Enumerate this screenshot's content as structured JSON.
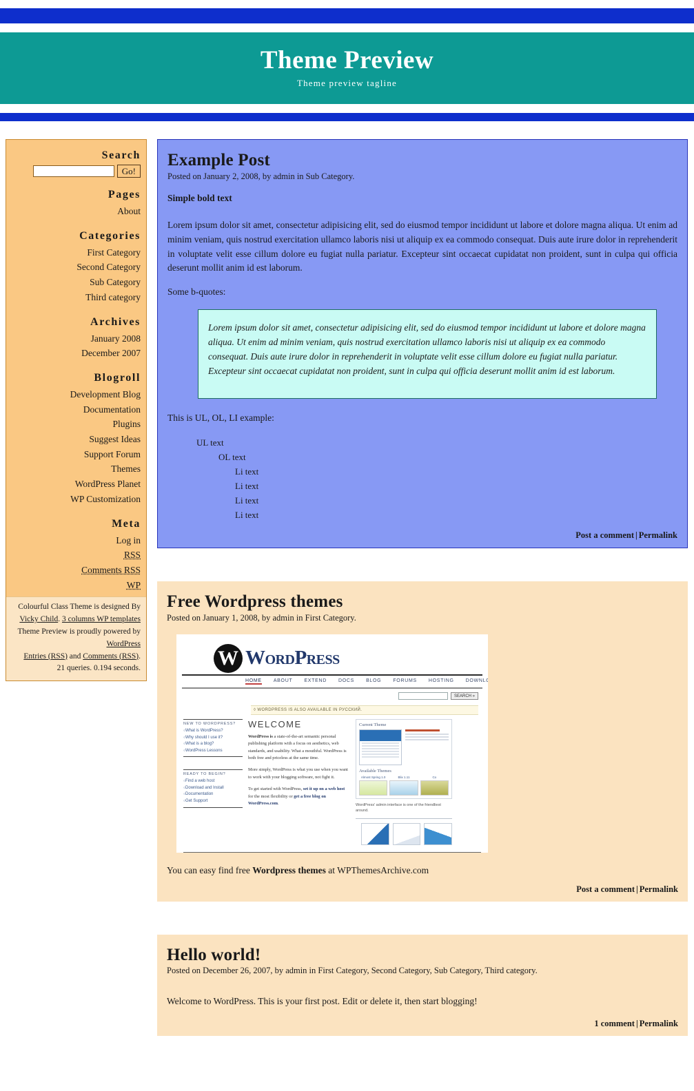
{
  "header": {
    "title": "Theme Preview",
    "tagline": "Theme preview tagline"
  },
  "colors": {
    "bar_blue": "#0e2ecc",
    "header_teal": "#0d9a94",
    "sidebar_orange": "#fac883",
    "sidebar_border": "#c98a30",
    "credit_bg": "#fbe5c5",
    "post_blue_bg": "#8799f4",
    "post_blue_border": "#2733b9",
    "post_peach_bg": "#fbe3c0",
    "blockquote_bg": "#c9fbf4",
    "blockquote_border": "#1d6b63"
  },
  "sidebar": {
    "search": {
      "heading": "Search",
      "value": "",
      "placeholder": "",
      "button_label": "Go!"
    },
    "pages": {
      "heading": "Pages",
      "items": [
        {
          "label": "About"
        }
      ]
    },
    "categories": {
      "heading": "Categories",
      "items": [
        {
          "label": "First Category",
          "sub": false
        },
        {
          "label": "Second Category",
          "sub": false
        },
        {
          "label": "Sub Category",
          "sub": true
        },
        {
          "label": "Third category",
          "sub": false
        }
      ]
    },
    "archives": {
      "heading": "Archives",
      "items": [
        {
          "label": "January 2008"
        },
        {
          "label": "December 2007"
        }
      ]
    },
    "blogroll": {
      "heading": "Blogroll",
      "items": [
        {
          "label": "Development Blog"
        },
        {
          "label": "Documentation"
        },
        {
          "label": "Plugins"
        },
        {
          "label": "Suggest Ideas"
        },
        {
          "label": "Support Forum"
        },
        {
          "label": "Themes"
        },
        {
          "label": "WordPress Planet"
        },
        {
          "label": "WP Customization"
        }
      ]
    },
    "meta": {
      "heading": "Meta",
      "items": [
        {
          "label": "Log in",
          "dotted": false
        },
        {
          "label": "RSS",
          "dotted": true
        },
        {
          "label": "Comments RSS",
          "dotted": true
        },
        {
          "label": "WP",
          "dotted": true
        }
      ]
    },
    "credit": {
      "line1_a": "Colourful Class Theme is designed By",
      "link_designer": "Vicky Child",
      "line1_sep": ". ",
      "link_templates": "3 columns WP templates",
      "line2_a": "Theme Preview is proudly powered by",
      "link_wordpress": "WordPress",
      "link_entries": "Entries (RSS)",
      "line3_and": " and ",
      "link_comments": "Comments (RSS)",
      "line3_end": ".",
      "queries": "21 queries. 0.194 seconds."
    }
  },
  "posts": [
    {
      "title": "Example Post",
      "meta": "Posted on January 2, 2008, by admin in Sub Category.",
      "bold_text": "Simple bold text",
      "body": "Lorem ipsum dolor sit amet, consectetur adipisicing elit, sed do eiusmod tempor incididunt ut labore et dolore magna aliqua. Ut enim ad minim veniam, quis nostrud exercitation ullamco laboris nisi ut aliquip ex ea commodo consequat. Duis aute irure dolor in reprehenderit in voluptate velit esse cillum dolore eu fugiat nulla pariatur. Excepteur sint occaecat cupidatat non proident, sunt in culpa qui officia deserunt mollit anim id est laborum.",
      "bquote_intro": "Some b-quotes:",
      "blockquote": "Lorem ipsum dolor sit amet, consectetur adipisicing elit, sed do eiusmod tempor incididunt ut labore et dolore magna aliqua. Ut enim ad minim veniam, quis nostrud exercitation ullamco laboris nisi ut aliquip ex ea commodo consequat. Duis aute irure dolor in reprehenderit in voluptate velit esse cillum dolore eu fugiat nulla pariatur. Excepteur sint occaecat cupidatat non proident, sunt in culpa qui officia deserunt mollit anim id est laborum.",
      "list_intro": "This is UL, OL, LI example:",
      "list": [
        {
          "label": "UL text",
          "level": 1
        },
        {
          "label": "OL text",
          "level": 2
        },
        {
          "label": "Li text",
          "level": 3
        },
        {
          "label": "Li text",
          "level": 3
        },
        {
          "label": "Li text",
          "level": 3
        },
        {
          "label": "Li text",
          "level": 3
        }
      ],
      "footer_comment": "Post a comment",
      "footer_sep": "|",
      "footer_permalink": "Permalink"
    },
    {
      "title": "Free Wordpress themes",
      "meta": "Posted on January 1, 2008, by admin in First Category.",
      "after_image_pre": "You can easy find free ",
      "after_image_bold": "Wordpress themes",
      "after_image_post": " at WPThemesArchive.com",
      "footer_comment": "Post a comment",
      "footer_sep": "|",
      "footer_permalink": "Permalink"
    },
    {
      "title": "Hello world!",
      "meta": "Posted on December 26, 2007, by admin in First Category, Second Category, Sub Category, Third category.",
      "body": "Welcome to WordPress. This is your first post. Edit or delete it, then start blogging!",
      "footer_comment": "1 comment",
      "footer_sep": "|",
      "footer_permalink": "Permalink"
    }
  ],
  "wp_screenshot": {
    "logo_w": "W",
    "wordmark": "WordPress",
    "nav": [
      "HOME",
      "ABOUT",
      "EXTEND",
      "DOCS",
      "BLOG",
      "FORUMS",
      "HOSTING",
      "DOWNLOAD"
    ],
    "search_button": "SEARCH »",
    "notice": "◊ WORDPRESS IS ALSO AVAILABLE IN РУССКИЙ.",
    "left_box1_heading": "NEW TO WORDPRESS?",
    "left_box1_items": [
      "What is WordPress?",
      "Why should I use it?",
      "What is a blog?",
      "WordPress Lessons"
    ],
    "left_box2_heading": "READY TO BEGIN?",
    "left_box2_items": [
      "Find a web host",
      "Download and Install",
      "Documentation",
      "Get Support"
    ],
    "welcome": "WELCOME",
    "para1_bold": "WordPress is",
    "para1": " a state-of-the-art semantic personal publishing platform with a focus on aesthetics, web standards, and usability. What a mouthful. WordPress is both free and priceless at the same time.",
    "para2": "More simply, WordPress is what you use when you want to work with your blogging software, not fight it.",
    "para3_pre": "To get started with WordPress, ",
    "para3_link1": "set it up on a web host",
    "para3_mid": " for the most flexibility or ",
    "para3_link2": "get a free blog on WordPress.com",
    "para3_end": ".",
    "panel_current": "Current Theme",
    "panel_available": "Available Themes",
    "theme_names": [
      "Almost Spring 1.0",
      "Blix 1.11",
      "Co"
    ],
    "caption": "WordPress' admin interface is one of the friendliest around."
  }
}
